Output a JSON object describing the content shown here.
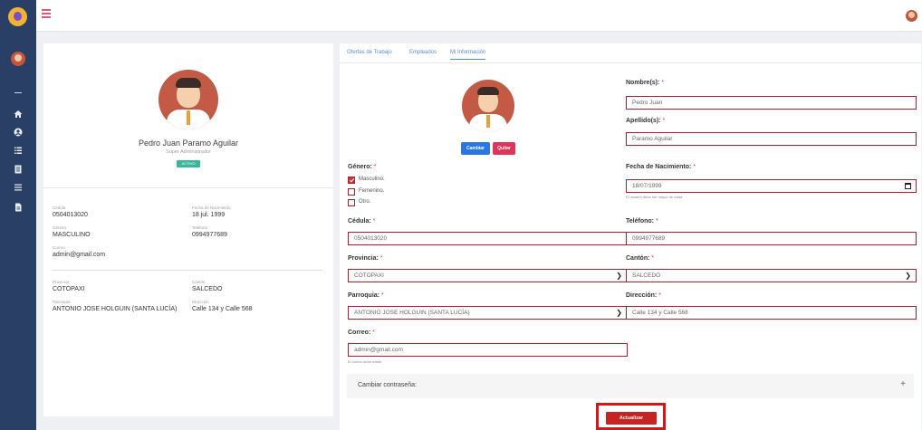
{
  "profile": {
    "name": "Pedro Juan Paramo Aguilar",
    "role": "Super Administrador",
    "status": "ACTIVO",
    "fields": {
      "cedula_label": "Cédula",
      "cedula_value": "0504013020",
      "nacimiento_label": "Fecha de Nacimiento",
      "nacimiento_value": "18 jul. 1999",
      "genero_label": "Género",
      "genero_value": "MASCULINO",
      "telefono_label": "Teléfono",
      "telefono_value": "0994977689",
      "correo_label": "Correo",
      "correo_value": "admin@gmail.com",
      "provincia_label": "Provincia",
      "provincia_value": "COTOPAXI",
      "canton_label": "Cantón",
      "canton_value": "SALCEDO",
      "parroquia_label": "Parroquia",
      "parroquia_value": "ANTONIO JOSE HOLGUIN (SANTA LUCÍA)",
      "direccion_label": "Dirección",
      "direccion_value": "Calle 134 y Calle 568"
    }
  },
  "tabs": [
    {
      "label": "Ofertas de Trabajo"
    },
    {
      "label": "Empleados"
    },
    {
      "label": "Mi Información"
    }
  ],
  "form": {
    "change_photo": "Cambiar",
    "remove_photo": "Quitar",
    "nombres_label": "Nombre(s):",
    "nombres_value": "Pedro Juan",
    "apellidos_label": "Apellido(s):",
    "apellidos_value": "Paramo Aguilar",
    "genero_label": "Género:",
    "genero_options": [
      "Masculino.",
      "Femenino.",
      "Otro."
    ],
    "fecha_label": "Fecha de Nacimiento:",
    "fecha_value": "18/07/1999",
    "fecha_hint": "El usuario debe ser mayor de edad.",
    "cedula_label": "Cédula:",
    "cedula_value": "0504013020",
    "telefono_label": "Teléfono:",
    "telefono_value": "0994977689",
    "provincia_label": "Provincia:",
    "provincia_value": "COTOPAXI",
    "canton_label": "Cantón:",
    "canton_value": "SALCEDO",
    "parroquia_label": "Parroquia:",
    "parroquia_value": "ANTONIO JOSE HOLGUIN (SANTA LUCÍA)",
    "direccion_label": "Dirección:",
    "direccion_value": "Calle 134 y Calle 568",
    "correo_label": "Correo:",
    "correo_value": "admin@gmail.com",
    "correo_hint": "El correo debe existir.",
    "required_mark": "*",
    "password_section": "Cambiar contraseña:",
    "expand_symbol": "+",
    "submit": "Actualizar"
  },
  "icons": {
    "menu": "hamburger-icon",
    "home": "home-icon",
    "user": "user-icon",
    "list": "list-icon",
    "document": "document-icon",
    "file": "file-icon"
  },
  "colors": {
    "sidebar": "#2a3f66",
    "accent_red": "#c82323",
    "field_border": "#b31d2b",
    "tab_link": "#5b8bd6",
    "status_green": "#37b89a"
  }
}
